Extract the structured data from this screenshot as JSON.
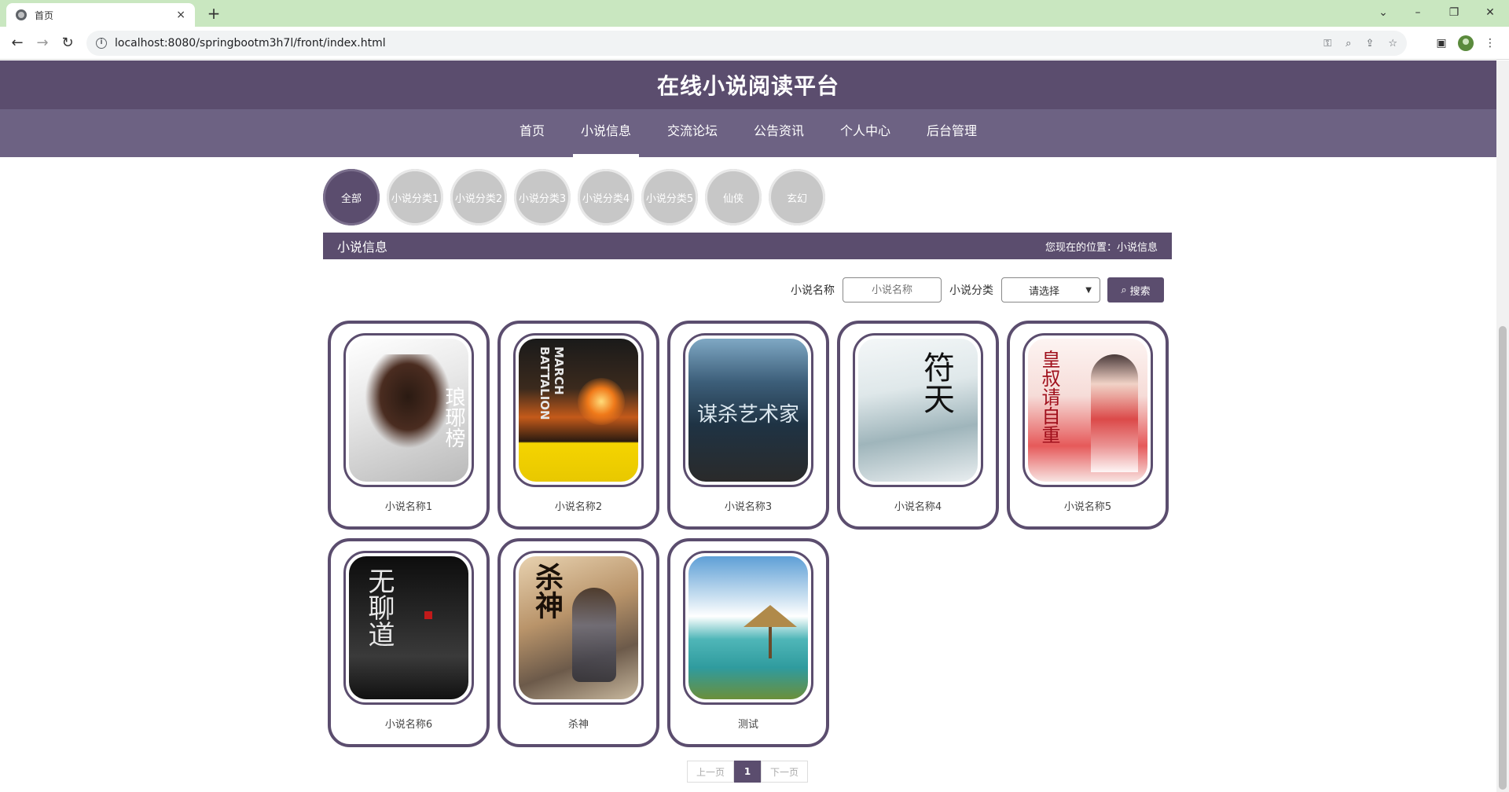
{
  "browser": {
    "tab_title": "首页",
    "tab_close": "×",
    "new_tab": "+",
    "url": "localhost:8080/springbootm3h7l/front/index.html"
  },
  "site": {
    "title": "在线小说阅读平台",
    "nav": [
      {
        "label": "首页"
      },
      {
        "label": "小说信息",
        "active": true
      },
      {
        "label": "交流论坛"
      },
      {
        "label": "公告资讯"
      },
      {
        "label": "个人中心"
      },
      {
        "label": "后台管理"
      }
    ]
  },
  "categories": [
    "全部",
    "小说分类1",
    "小说分类2",
    "小说分类3",
    "小说分类4",
    "小说分类5",
    "仙侠",
    "玄幻"
  ],
  "section": {
    "title": "小说信息",
    "breadcrumb": "您现在的位置：小说信息"
  },
  "search": {
    "name_label": "小说名称",
    "name_placeholder": "小说名称",
    "category_label": "小说分类",
    "category_value": "请选择",
    "button_label": "搜索"
  },
  "novels": [
    {
      "title": "小说名称1",
      "cover_text": "琅琊榜"
    },
    {
      "title": "小说名称2",
      "cover_text": "MARCH BATTALION"
    },
    {
      "title": "小说名称3",
      "cover_text": "谋杀艺术家"
    },
    {
      "title": "小说名称4",
      "cover_text": "符天"
    },
    {
      "title": "小说名称5",
      "cover_text": "皇叔请自重"
    },
    {
      "title": "小说名称6",
      "cover_text": "无聊道"
    },
    {
      "title": "杀神",
      "cover_text": "杀神"
    },
    {
      "title": "测试",
      "cover_text": ""
    }
  ],
  "pagination": {
    "prev": "上一页",
    "current": "1",
    "next": "下一页"
  },
  "colors": {
    "primary": "#5b4d6e",
    "nav_bg": "#6d6283",
    "category_inactive": "#c7c7c7"
  }
}
